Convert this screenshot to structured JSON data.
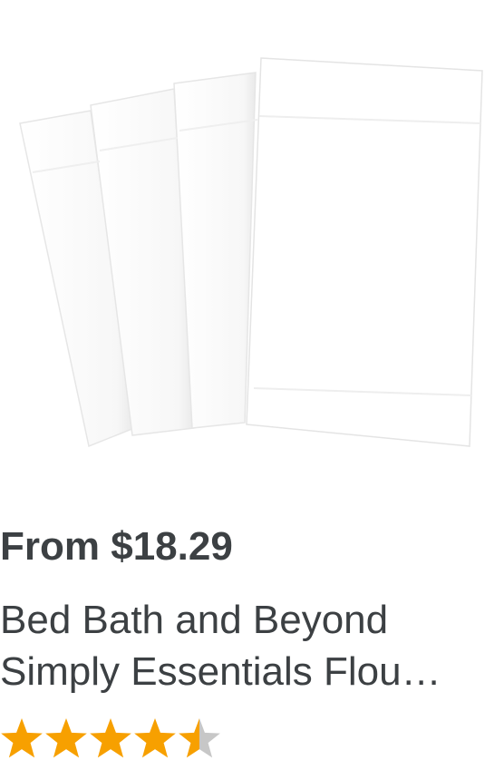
{
  "product": {
    "image_alt": "white flour sack towels",
    "price": "From $18.29",
    "title_line1": "Bed Bath and Beyond",
    "title_line2": "Simply Essentials Flou…",
    "rating": 4.5,
    "rating_max": 5,
    "star_color": "#f7a000",
    "star_empty_color": "#c7c7c7"
  }
}
